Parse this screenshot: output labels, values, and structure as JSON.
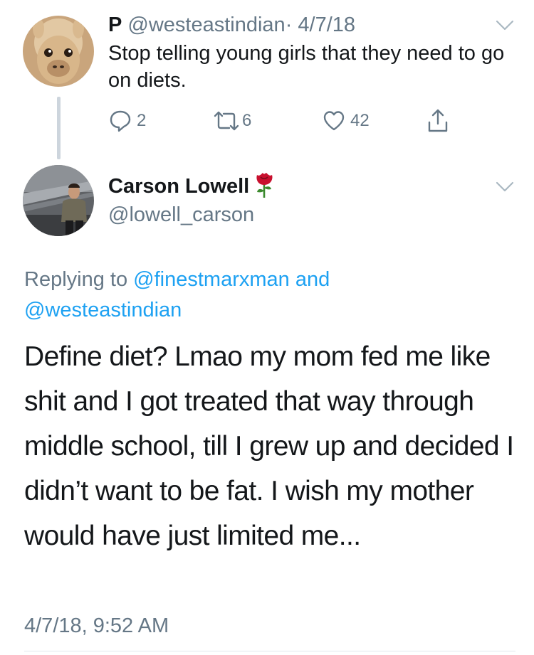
{
  "parent_tweet": {
    "name": "P",
    "handle": "@westeastindian",
    "separator": "·",
    "date": "4/7/18",
    "text": "Stop telling young girls that they need to go on diets.",
    "avatar_icon": "alpaca-avatar",
    "actions": {
      "reply_count": "2",
      "retweet_count": "6",
      "like_count": "42"
    }
  },
  "reply_tweet": {
    "name": "Carson Lowell",
    "name_emoji": "rose-emoji",
    "handle": "@lowell_carson",
    "avatar_icon": "person-photo-avatar",
    "replying_prefix": "Replying to",
    "replying_mention_1": "@finestmarxman",
    "replying_and": "and",
    "replying_mention_2": "@westeastindian",
    "text": "Define diet? Lmao my mom fed me like shit and I got treated that way through middle school, till I grew up and decided I didn’t want to be fat. I wish my mother would have just limited me...",
    "timestamp": "4/7/18, 9:52 AM"
  },
  "colors": {
    "text_primary": "#14171a",
    "text_secondary": "#657786",
    "link": "#1da1f2",
    "thread_line": "#cdd5dd",
    "rose": "#c8102e"
  }
}
